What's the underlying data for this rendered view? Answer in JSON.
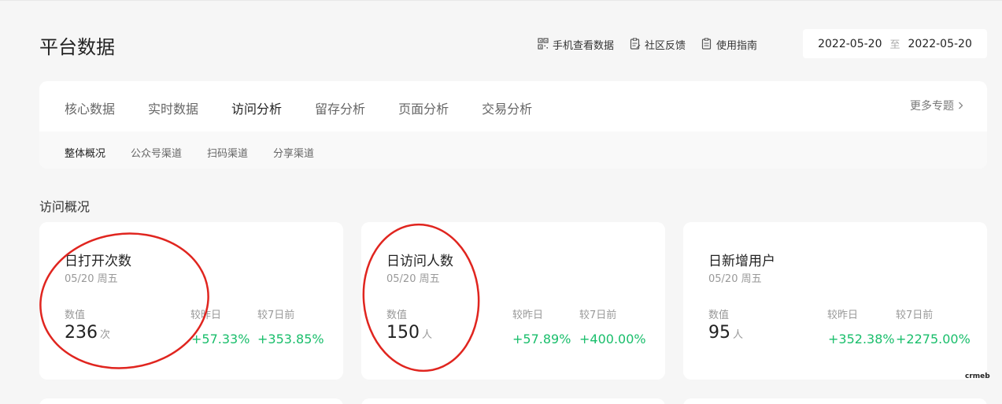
{
  "header": {
    "title": "平台数据",
    "links": [
      {
        "label": "手机查看数据",
        "icon": "qr-code-icon"
      },
      {
        "label": "社区反馈",
        "icon": "feedback-icon"
      },
      {
        "label": "使用指南",
        "icon": "guide-icon"
      }
    ],
    "date_range": {
      "start": "2022-05-20",
      "separator": "至",
      "end": "2022-05-20"
    }
  },
  "nav": {
    "tabs": [
      "核心数据",
      "实时数据",
      "访问分析",
      "留存分析",
      "页面分析",
      "交易分析"
    ],
    "active_tab": "访问分析",
    "more_label": "更多专题",
    "subtabs": [
      "整体概况",
      "公众号渠道",
      "扫码渠道",
      "分享渠道"
    ],
    "active_subtab": "整体概况"
  },
  "section": {
    "title": "访问概况"
  },
  "labels": {
    "value": "数值",
    "vs_yesterday": "较昨日",
    "vs_7days": "较7日前"
  },
  "cards": [
    {
      "title": "日打开次数",
      "date": "05/20 周五",
      "value": "236",
      "unit": "次",
      "vs_yesterday": "+57.33%",
      "vs_7days": "+353.85%"
    },
    {
      "title": "日访问人数",
      "date": "05/20 周五",
      "value": "150",
      "unit": "人",
      "vs_yesterday": "+57.89%",
      "vs_7days": "+400.00%"
    },
    {
      "title": "日新增用户",
      "date": "05/20 周五",
      "value": "95",
      "unit": "人",
      "vs_yesterday": "+352.38%",
      "vs_7days": "+2275.00%"
    }
  ],
  "watermark": "crmeb",
  "colors": {
    "positive": "#19be6b",
    "annotation": "#e0251f",
    "background": "#f6f6f6"
  }
}
